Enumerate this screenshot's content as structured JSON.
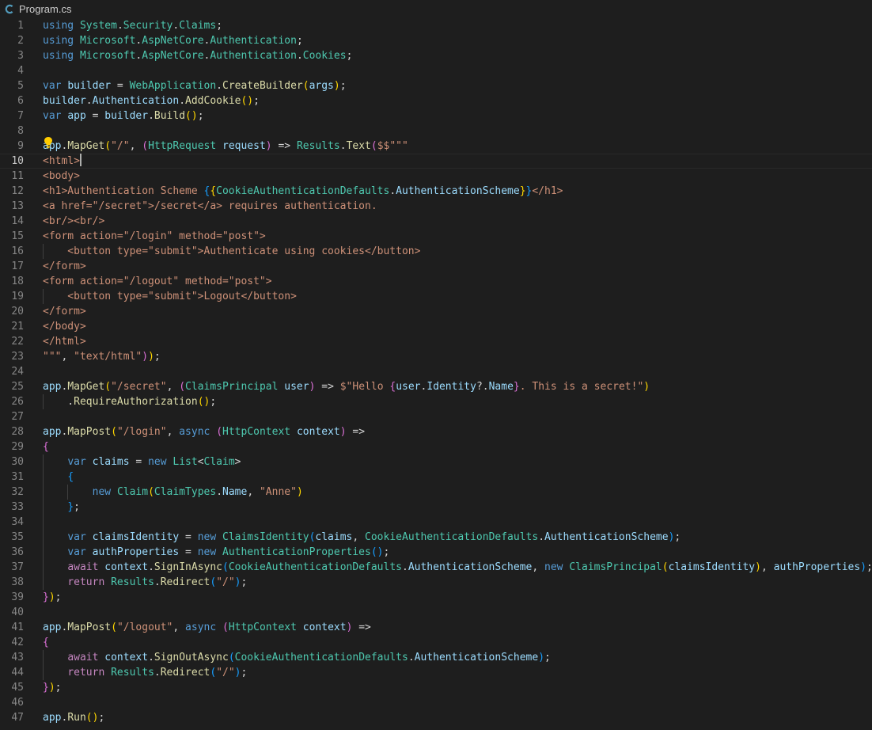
{
  "tab": {
    "filename": "Program.cs",
    "icon": "csharp-file-icon"
  },
  "editor": {
    "current_line": 10,
    "line_count": 47,
    "lightbulb_icon": "lightbulb-icon"
  },
  "colors": {
    "background": "#1e1e1e",
    "line_number": "#858585",
    "keyword": "#569cd6",
    "type": "#4ec9b0",
    "function": "#dcdcaa",
    "variable": "#9cdcfe",
    "string": "#ce9178",
    "bracket_1": "#ffd700",
    "bracket_2": "#da70d6",
    "bracket_3": "#179fff"
  },
  "code_lines": [
    [
      [
        "kw",
        "using"
      ],
      [
        "pun",
        " "
      ],
      [
        "ty",
        "System"
      ],
      [
        "pun",
        "."
      ],
      [
        "ty",
        "Security"
      ],
      [
        "pun",
        "."
      ],
      [
        "ty",
        "Claims"
      ],
      [
        "pun",
        ";"
      ]
    ],
    [
      [
        "kw",
        "using"
      ],
      [
        "pun",
        " "
      ],
      [
        "ty",
        "Microsoft"
      ],
      [
        "pun",
        "."
      ],
      [
        "ty",
        "AspNetCore"
      ],
      [
        "pun",
        "."
      ],
      [
        "ty",
        "Authentication"
      ],
      [
        "pun",
        ";"
      ]
    ],
    [
      [
        "kw",
        "using"
      ],
      [
        "pun",
        " "
      ],
      [
        "ty",
        "Microsoft"
      ],
      [
        "pun",
        "."
      ],
      [
        "ty",
        "AspNetCore"
      ],
      [
        "pun",
        "."
      ],
      [
        "ty",
        "Authentication"
      ],
      [
        "pun",
        "."
      ],
      [
        "ty",
        "Cookies"
      ],
      [
        "pun",
        ";"
      ]
    ],
    [],
    [
      [
        "kw",
        "var"
      ],
      [
        "pun",
        " "
      ],
      [
        "var",
        "builder"
      ],
      [
        "pun",
        " = "
      ],
      [
        "ty",
        "WebApplication"
      ],
      [
        "pun",
        "."
      ],
      [
        "fn",
        "CreateBuilder"
      ],
      [
        "b1",
        "("
      ],
      [
        "var",
        "args"
      ],
      [
        "b1",
        ")"
      ],
      [
        "pun",
        ";"
      ]
    ],
    [
      [
        "var",
        "builder"
      ],
      [
        "pun",
        "."
      ],
      [
        "var",
        "Authentication"
      ],
      [
        "pun",
        "."
      ],
      [
        "fn",
        "AddCookie"
      ],
      [
        "b1",
        "()"
      ],
      [
        "pun",
        ";"
      ]
    ],
    [
      [
        "kw",
        "var"
      ],
      [
        "pun",
        " "
      ],
      [
        "var",
        "app"
      ],
      [
        "pun",
        " = "
      ],
      [
        "var",
        "builder"
      ],
      [
        "pun",
        "."
      ],
      [
        "fn",
        "Build"
      ],
      [
        "b1",
        "()"
      ],
      [
        "pun",
        ";"
      ]
    ],
    [],
    [
      [
        "var",
        "app"
      ],
      [
        "pun",
        "."
      ],
      [
        "fn",
        "MapGet"
      ],
      [
        "b1",
        "("
      ],
      [
        "str",
        "\"/\""
      ],
      [
        "pun",
        ", "
      ],
      [
        "b2",
        "("
      ],
      [
        "ty",
        "HttpRequest"
      ],
      [
        "pun",
        " "
      ],
      [
        "var",
        "request"
      ],
      [
        "b2",
        ")"
      ],
      [
        "pun",
        " => "
      ],
      [
        "ty",
        "Results"
      ],
      [
        "pun",
        "."
      ],
      [
        "fn",
        "Text"
      ],
      [
        "b2",
        "("
      ],
      [
        "str",
        "$$\"\"\""
      ]
    ],
    [
      [
        "str",
        "<html>"
      ],
      [
        "cursor",
        ""
      ]
    ],
    [
      [
        "str",
        "<body>"
      ]
    ],
    [
      [
        "str",
        "<h1>Authentication Scheme "
      ],
      [
        "b3",
        "{"
      ],
      [
        "b1",
        "{"
      ],
      [
        "ty",
        "CookieAuthenticationDefaults"
      ],
      [
        "pun",
        "."
      ],
      [
        "var",
        "AuthenticationScheme"
      ],
      [
        "b1",
        "}"
      ],
      [
        "b3",
        "}"
      ],
      [
        "str",
        "</h1>"
      ]
    ],
    [
      [
        "str",
        "<a href=\"/secret\">/secret</a> requires authentication."
      ]
    ],
    [
      [
        "str",
        "<br/><br/>"
      ]
    ],
    [
      [
        "str",
        "<form action=\"/login\" method=\"post\">"
      ]
    ],
    [
      [
        "str",
        "    <button type=\"submit\">Authenticate using cookies</button>"
      ]
    ],
    [
      [
        "str",
        "</form>"
      ]
    ],
    [
      [
        "str",
        "<form action=\"/logout\" method=\"post\">"
      ]
    ],
    [
      [
        "str",
        "    <button type=\"submit\">Logout</button>"
      ]
    ],
    [
      [
        "str",
        "</form>"
      ]
    ],
    [
      [
        "str",
        "</body>"
      ]
    ],
    [
      [
        "str",
        "</html>"
      ]
    ],
    [
      [
        "str",
        "\"\"\""
      ],
      [
        "pun",
        ", "
      ],
      [
        "str",
        "\"text/html\""
      ],
      [
        "b2",
        ")"
      ],
      [
        "b1",
        ")"
      ],
      [
        "pun",
        ";"
      ]
    ],
    [],
    [
      [
        "var",
        "app"
      ],
      [
        "pun",
        "."
      ],
      [
        "fn",
        "MapGet"
      ],
      [
        "b1",
        "("
      ],
      [
        "str",
        "\"/secret\""
      ],
      [
        "pun",
        ", "
      ],
      [
        "b2",
        "("
      ],
      [
        "ty",
        "ClaimsPrincipal"
      ],
      [
        "pun",
        " "
      ],
      [
        "var",
        "user"
      ],
      [
        "b2",
        ")"
      ],
      [
        "pun",
        " => "
      ],
      [
        "str",
        "$\"Hello "
      ],
      [
        "b2",
        "{"
      ],
      [
        "var",
        "user"
      ],
      [
        "pun",
        "."
      ],
      [
        "var",
        "Identity"
      ],
      [
        "pun",
        "?."
      ],
      [
        "var",
        "Name"
      ],
      [
        "b2",
        "}"
      ],
      [
        "str",
        ". This is a secret!\""
      ],
      [
        "b1",
        ")"
      ]
    ],
    [
      [
        "pun",
        "    ."
      ],
      [
        "fn",
        "RequireAuthorization"
      ],
      [
        "b1",
        "()"
      ],
      [
        "pun",
        ";"
      ]
    ],
    [],
    [
      [
        "var",
        "app"
      ],
      [
        "pun",
        "."
      ],
      [
        "fn",
        "MapPost"
      ],
      [
        "b1",
        "("
      ],
      [
        "str",
        "\"/login\""
      ],
      [
        "pun",
        ", "
      ],
      [
        "kw",
        "async"
      ],
      [
        "pun",
        " "
      ],
      [
        "b2",
        "("
      ],
      [
        "ty",
        "HttpContext"
      ],
      [
        "pun",
        " "
      ],
      [
        "var",
        "context"
      ],
      [
        "b2",
        ")"
      ],
      [
        "pun",
        " =>"
      ]
    ],
    [
      [
        "b2",
        "{"
      ]
    ],
    [
      [
        "pun",
        "    "
      ],
      [
        "kw",
        "var"
      ],
      [
        "pun",
        " "
      ],
      [
        "var",
        "claims"
      ],
      [
        "pun",
        " = "
      ],
      [
        "kw",
        "new"
      ],
      [
        "pun",
        " "
      ],
      [
        "ty",
        "List"
      ],
      [
        "pun",
        "<"
      ],
      [
        "ty",
        "Claim"
      ],
      [
        "pun",
        ">"
      ]
    ],
    [
      [
        "pun",
        "    "
      ],
      [
        "b3",
        "{"
      ]
    ],
    [
      [
        "pun",
        "        "
      ],
      [
        "kw",
        "new"
      ],
      [
        "pun",
        " "
      ],
      [
        "ty",
        "Claim"
      ],
      [
        "b1",
        "("
      ],
      [
        "ty",
        "ClaimTypes"
      ],
      [
        "pun",
        "."
      ],
      [
        "var",
        "Name"
      ],
      [
        "pun",
        ", "
      ],
      [
        "str",
        "\"Anne\""
      ],
      [
        "b1",
        ")"
      ]
    ],
    [
      [
        "pun",
        "    "
      ],
      [
        "b3",
        "}"
      ],
      [
        "pun",
        ";"
      ]
    ],
    [],
    [
      [
        "pun",
        "    "
      ],
      [
        "kw",
        "var"
      ],
      [
        "pun",
        " "
      ],
      [
        "var",
        "claimsIdentity"
      ],
      [
        "pun",
        " = "
      ],
      [
        "kw",
        "new"
      ],
      [
        "pun",
        " "
      ],
      [
        "ty",
        "ClaimsIdentity"
      ],
      [
        "b3",
        "("
      ],
      [
        "var",
        "claims"
      ],
      [
        "pun",
        ", "
      ],
      [
        "ty",
        "CookieAuthenticationDefaults"
      ],
      [
        "pun",
        "."
      ],
      [
        "var",
        "AuthenticationScheme"
      ],
      [
        "b3",
        ")"
      ],
      [
        "pun",
        ";"
      ]
    ],
    [
      [
        "pun",
        "    "
      ],
      [
        "kw",
        "var"
      ],
      [
        "pun",
        " "
      ],
      [
        "var",
        "authProperties"
      ],
      [
        "pun",
        " = "
      ],
      [
        "kw",
        "new"
      ],
      [
        "pun",
        " "
      ],
      [
        "ty",
        "AuthenticationProperties"
      ],
      [
        "b3",
        "()"
      ],
      [
        "pun",
        ";"
      ]
    ],
    [
      [
        "pun",
        "    "
      ],
      [
        "ctl",
        "await"
      ],
      [
        "pun",
        " "
      ],
      [
        "var",
        "context"
      ],
      [
        "pun",
        "."
      ],
      [
        "fn",
        "SignInAsync"
      ],
      [
        "b3",
        "("
      ],
      [
        "ty",
        "CookieAuthenticationDefaults"
      ],
      [
        "pun",
        "."
      ],
      [
        "var",
        "AuthenticationScheme"
      ],
      [
        "pun",
        ", "
      ],
      [
        "kw",
        "new"
      ],
      [
        "pun",
        " "
      ],
      [
        "ty",
        "ClaimsPrincipal"
      ],
      [
        "b1",
        "("
      ],
      [
        "var",
        "claimsIdentity"
      ],
      [
        "b1",
        ")"
      ],
      [
        "pun",
        ", "
      ],
      [
        "var",
        "authProperties"
      ],
      [
        "b3",
        ")"
      ],
      [
        "pun",
        ";"
      ]
    ],
    [
      [
        "pun",
        "    "
      ],
      [
        "ctl",
        "return"
      ],
      [
        "pun",
        " "
      ],
      [
        "ty",
        "Results"
      ],
      [
        "pun",
        "."
      ],
      [
        "fn",
        "Redirect"
      ],
      [
        "b3",
        "("
      ],
      [
        "str",
        "\"/\""
      ],
      [
        "b3",
        ")"
      ],
      [
        "pun",
        ";"
      ]
    ],
    [
      [
        "b2",
        "}"
      ],
      [
        "b1",
        ")"
      ],
      [
        "pun",
        ";"
      ]
    ],
    [],
    [
      [
        "var",
        "app"
      ],
      [
        "pun",
        "."
      ],
      [
        "fn",
        "MapPost"
      ],
      [
        "b1",
        "("
      ],
      [
        "str",
        "\"/logout\""
      ],
      [
        "pun",
        ", "
      ],
      [
        "kw",
        "async"
      ],
      [
        "pun",
        " "
      ],
      [
        "b2",
        "("
      ],
      [
        "ty",
        "HttpContext"
      ],
      [
        "pun",
        " "
      ],
      [
        "var",
        "context"
      ],
      [
        "b2",
        ")"
      ],
      [
        "pun",
        " =>"
      ]
    ],
    [
      [
        "b2",
        "{"
      ]
    ],
    [
      [
        "pun",
        "    "
      ],
      [
        "ctl",
        "await"
      ],
      [
        "pun",
        " "
      ],
      [
        "var",
        "context"
      ],
      [
        "pun",
        "."
      ],
      [
        "fn",
        "SignOutAsync"
      ],
      [
        "b3",
        "("
      ],
      [
        "ty",
        "CookieAuthenticationDefaults"
      ],
      [
        "pun",
        "."
      ],
      [
        "var",
        "AuthenticationScheme"
      ],
      [
        "b3",
        ")"
      ],
      [
        "pun",
        ";"
      ]
    ],
    [
      [
        "pun",
        "    "
      ],
      [
        "ctl",
        "return"
      ],
      [
        "pun",
        " "
      ],
      [
        "ty",
        "Results"
      ],
      [
        "pun",
        "."
      ],
      [
        "fn",
        "Redirect"
      ],
      [
        "b3",
        "("
      ],
      [
        "str",
        "\"/\""
      ],
      [
        "b3",
        ")"
      ],
      [
        "pun",
        ";"
      ]
    ],
    [
      [
        "b2",
        "}"
      ],
      [
        "b1",
        ")"
      ],
      [
        "pun",
        ";"
      ]
    ],
    [],
    [
      [
        "var",
        "app"
      ],
      [
        "pun",
        "."
      ],
      [
        "fn",
        "Run"
      ],
      [
        "b1",
        "()"
      ],
      [
        "pun",
        ";"
      ]
    ]
  ]
}
